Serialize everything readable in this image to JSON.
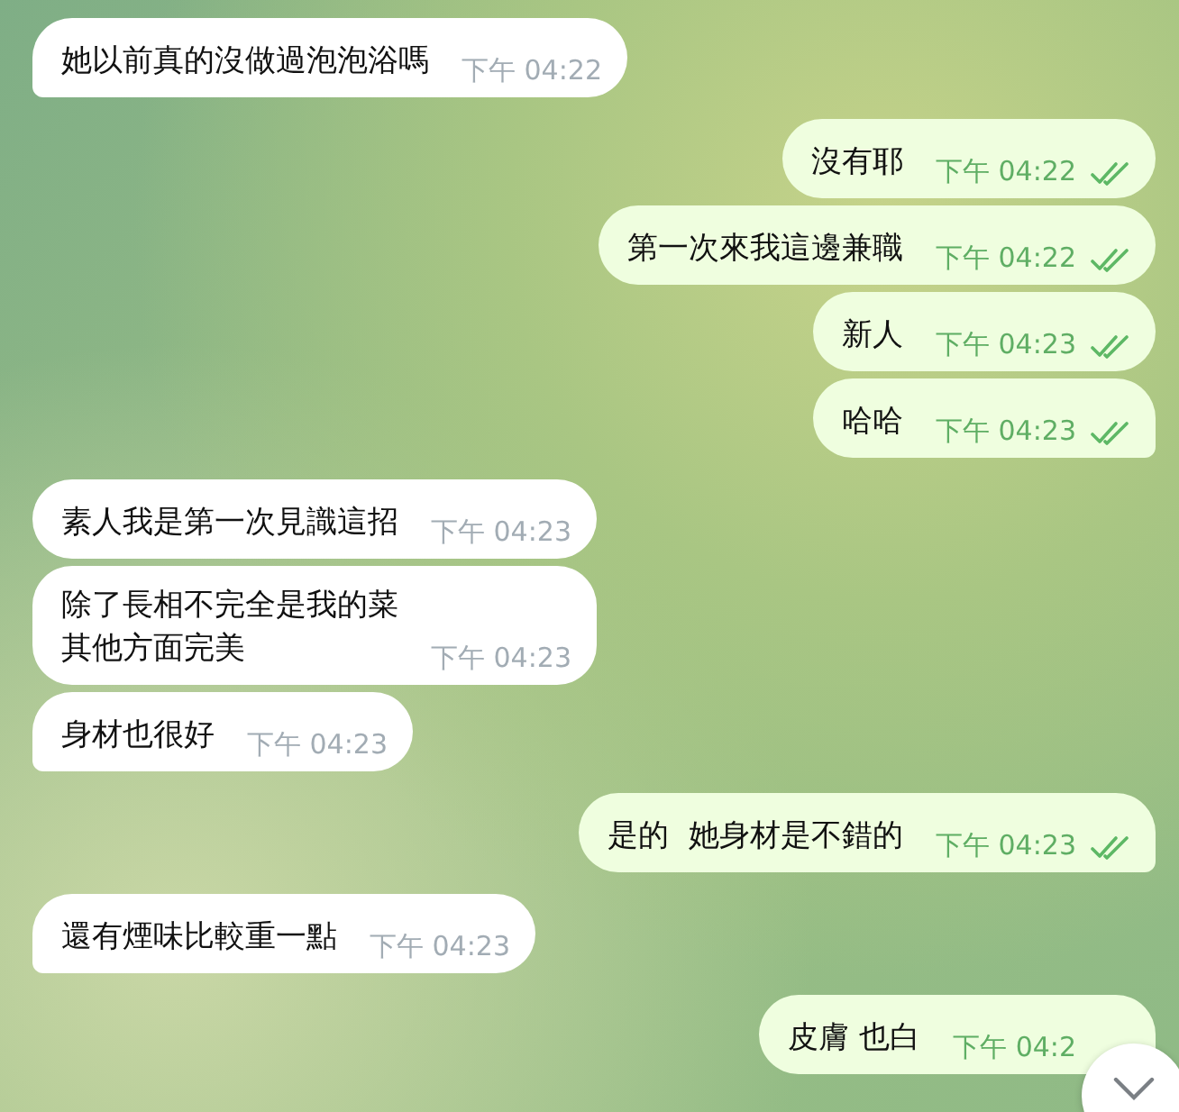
{
  "messages": [
    {
      "kind": "incoming",
      "lines": [
        "她以前真的沒做過泡泡浴嗎"
      ],
      "time": "下午 04:22"
    },
    {
      "kind": "outgoing",
      "lines": [
        "沒有耶"
      ],
      "time": "下午 04:22",
      "read": true
    },
    {
      "kind": "outgoing",
      "lines": [
        "第一次來我這邊兼職"
      ],
      "time": "下午 04:22",
      "read": true
    },
    {
      "kind": "outgoing",
      "lines": [
        "新人"
      ],
      "time": "下午 04:23",
      "read": true
    },
    {
      "kind": "outgoing",
      "lines": [
        "哈哈"
      ],
      "time": "下午 04:23",
      "read": true
    },
    {
      "kind": "incoming",
      "lines": [
        "素人我是第一次見識這招"
      ],
      "time": "下午 04:23"
    },
    {
      "kind": "incoming",
      "lines": [
        "除了長相不完全是我的菜",
        "其他方面完美"
      ],
      "time": "下午 04:23"
    },
    {
      "kind": "incoming",
      "lines": [
        "身材也很好"
      ],
      "time": "下午 04:23"
    },
    {
      "kind": "outgoing",
      "lines": [
        "是的  她身材是不錯的"
      ],
      "time": "下午 04:23",
      "read": true
    },
    {
      "kind": "incoming",
      "lines": [
        "還有煙味比較重一點"
      ],
      "time": "下午 04:23"
    },
    {
      "kind": "outgoing",
      "lines": [
        "皮膚 也白"
      ],
      "time": "下午 04:2"
    }
  ]
}
